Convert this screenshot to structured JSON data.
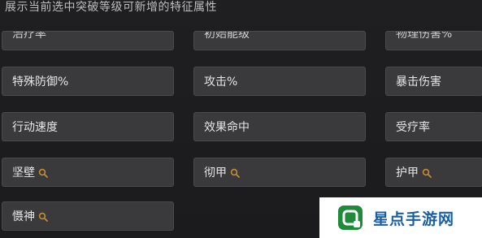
{
  "header": {
    "title": "展示当前选中突破等级可新增的特征属性"
  },
  "attributes": {
    "row0": [
      "治疗率",
      "初始能级",
      "物理伤害%"
    ],
    "row1": [
      "特殊防御%",
      "攻击%",
      "暴击伤害"
    ],
    "row2": [
      "行动速度",
      "效果命中",
      "受疗率"
    ],
    "row3": [
      "坚壁",
      "彻甲",
      "护甲"
    ],
    "row4": [
      "慑神"
    ]
  },
  "watermark": {
    "text": "星点手游网",
    "logo_colors": [
      "#1f8a3a",
      "#ffffff"
    ]
  },
  "colors": {
    "background": "#1b1b1d",
    "tile": "#3a3a3c",
    "tile_border": "#4a4a4c",
    "text": "#e6e6e6",
    "search_icon": "#c98a2a",
    "watermark_text": "#1a5fa0"
  }
}
